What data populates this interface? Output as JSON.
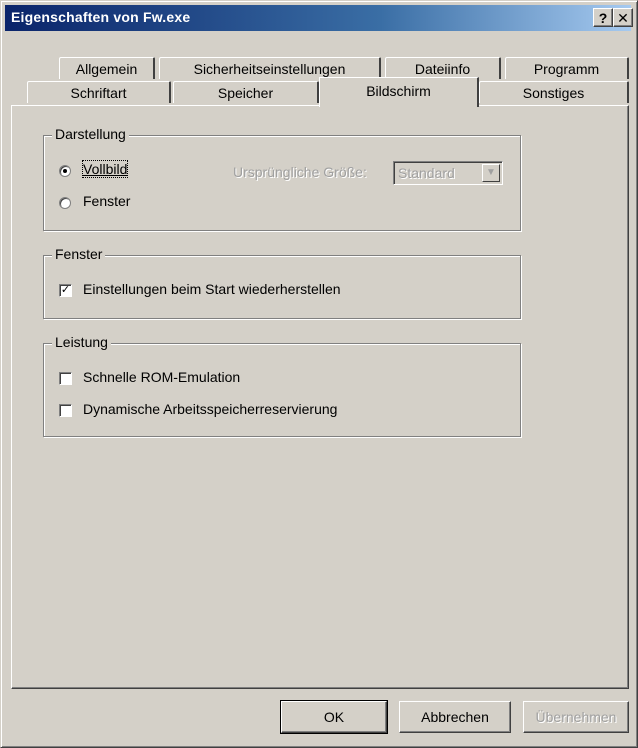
{
  "window": {
    "title": "Eigenschaften von Fw.exe",
    "help_glyph": "?",
    "close_glyph": "✕"
  },
  "tabs": {
    "row_top": [
      "Allgemein",
      "Sicherheitseinstellungen",
      "Dateiinfo",
      "Programm"
    ],
    "row_bottom": [
      "Schriftart",
      "Speicher",
      "Bildschirm",
      "Sonstiges"
    ],
    "active": "Bildschirm"
  },
  "darstellung": {
    "legend": "Darstellung",
    "radio_vollbild": "Vollbild",
    "radio_fenster": "Fenster",
    "selected": "Vollbild",
    "size_label": "Ursprüngliche Größe:",
    "size_value": "Standard"
  },
  "fenster_group": {
    "legend": "Fenster",
    "checkbox_restore": "Einstellungen beim Start wiederherstellen",
    "restore_checked": true
  },
  "leistung": {
    "legend": "Leistung",
    "checkbox_rom": "Schnelle ROM-Emulation",
    "rom_checked": false,
    "checkbox_memory": "Dynamische Arbeitsspeicherreservierung",
    "memory_checked": false
  },
  "buttons": {
    "ok": "OK",
    "cancel": "Abbrechen",
    "apply": "Übernehmen"
  }
}
